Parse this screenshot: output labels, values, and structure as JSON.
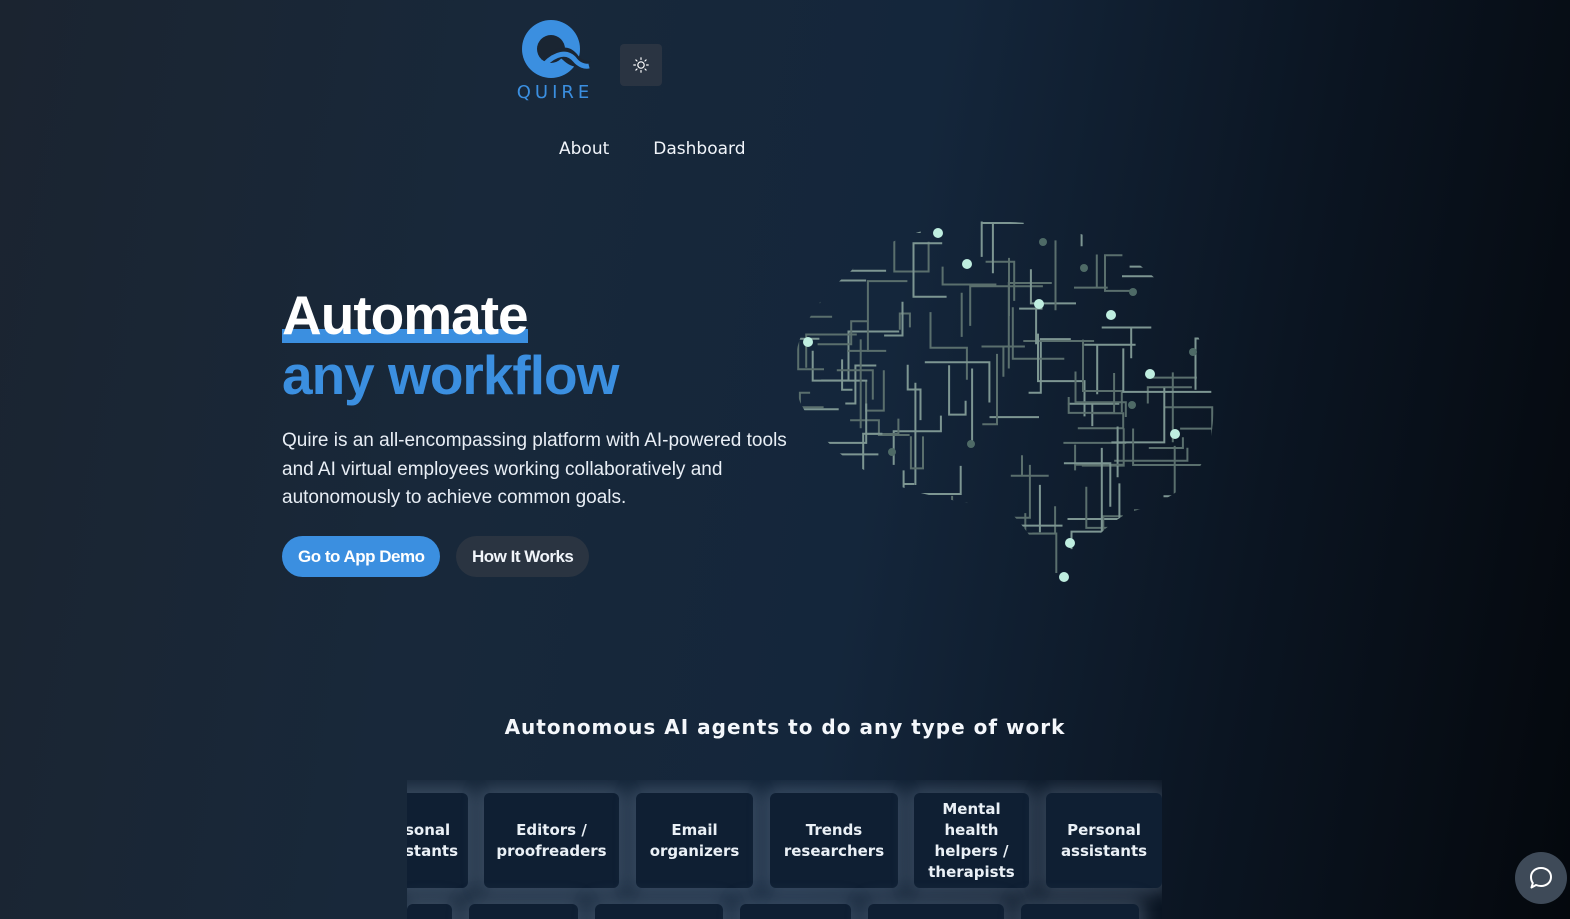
{
  "logo": {
    "text": "QUIRE"
  },
  "nav": {
    "about": "About",
    "dashboard": "Dashboard"
  },
  "hero": {
    "title_line1": "Automate",
    "title_line2": "any workflow",
    "description": "Quire is an all-encompassing platform with AI-powered tools and AI virtual employees working collaboratively and autonomously to achieve common goals.",
    "primary_button": "Go to App Demo",
    "secondary_button": "How It Works"
  },
  "agents": {
    "title": "Autonomous AI agents to do any type of work",
    "cards": [
      "sonal\nstants",
      "Editors /\nproofreaders",
      "Email\norganizers",
      "Trends\nresearchers",
      "Mental\nhealth\nhelpers /\ntherapists",
      "Personal\nassistants"
    ]
  },
  "colors": {
    "accent": "#3b8fe0",
    "button_secondary": "#2a3441",
    "card_bg": "#0f1f33"
  },
  "icons": {
    "theme_toggle": "sun-icon",
    "chat": "chat-bubble-icon"
  }
}
